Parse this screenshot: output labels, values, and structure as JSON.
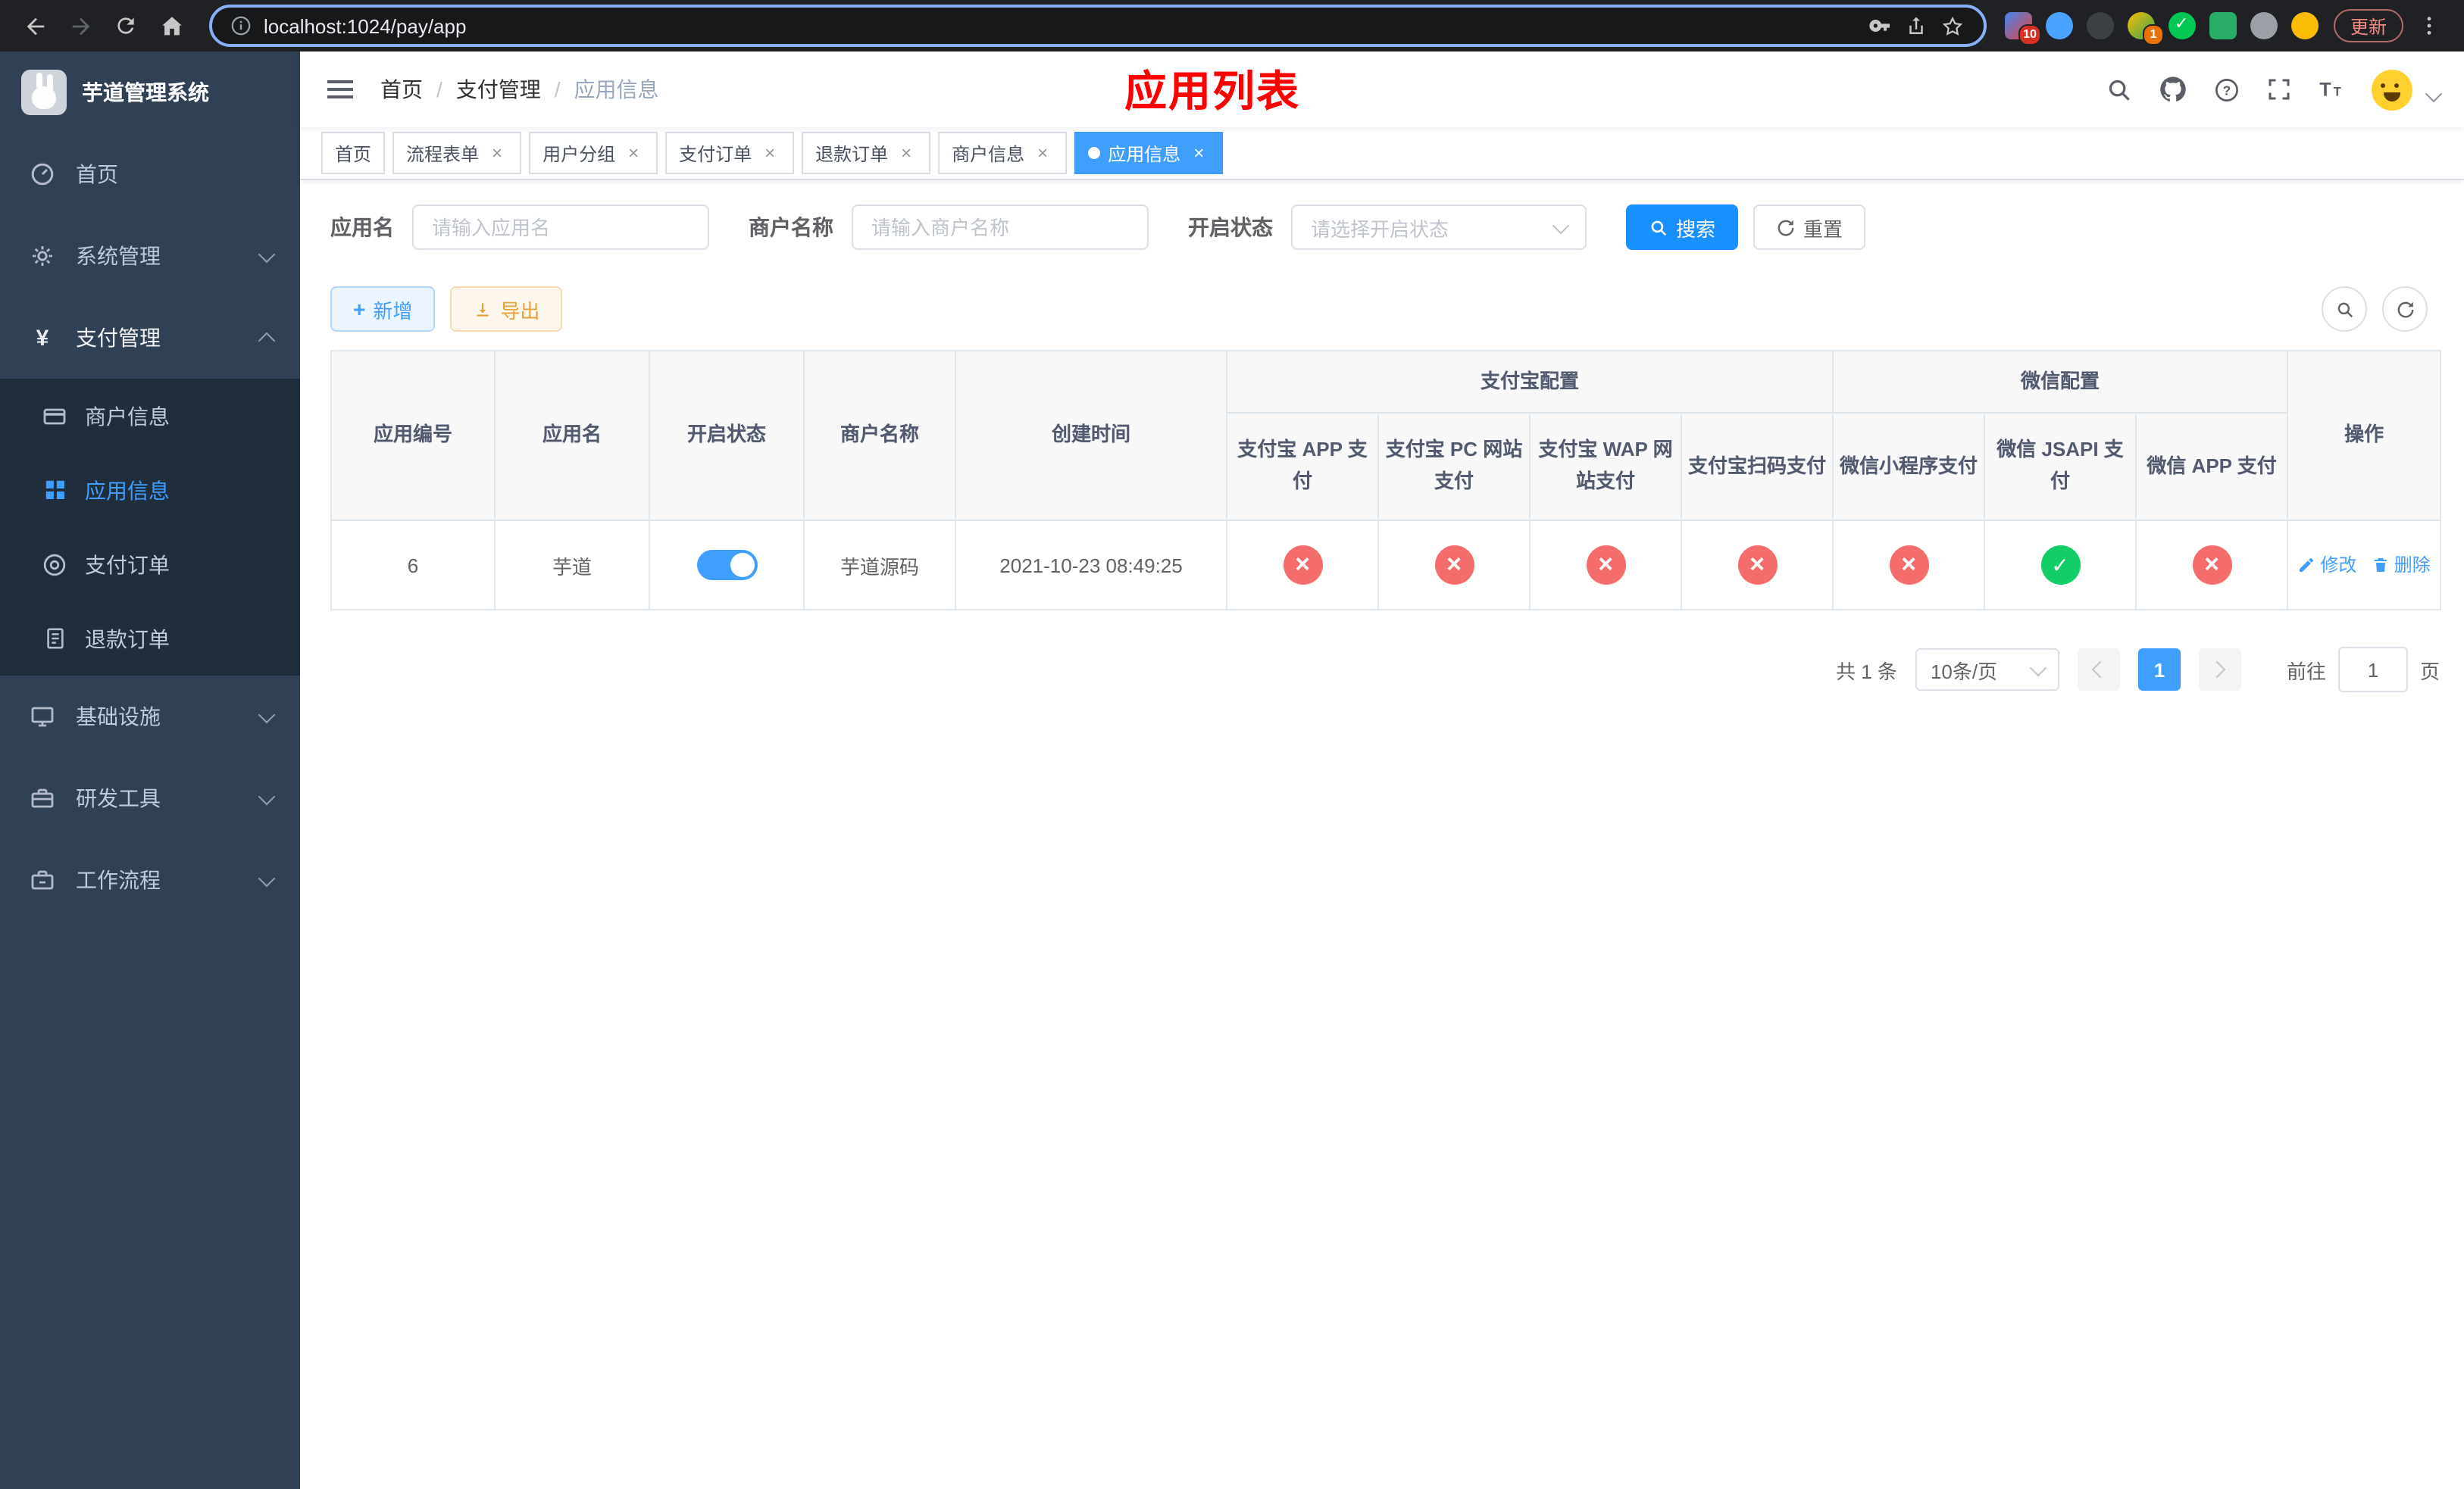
{
  "browser": {
    "url": "localhost:1024/pay/app",
    "update_label": "更新",
    "extensions_badge": "10",
    "profile_badge": "1"
  },
  "sidebar": {
    "logo_title": "芋道管理系统",
    "items": [
      {
        "label": "首页"
      },
      {
        "label": "系统管理"
      },
      {
        "label": "支付管理"
      },
      {
        "label": "商户信息"
      },
      {
        "label": "应用信息"
      },
      {
        "label": "支付订单"
      },
      {
        "label": "退款订单"
      },
      {
        "label": "基础设施"
      },
      {
        "label": "研发工具"
      },
      {
        "label": "工作流程"
      }
    ]
  },
  "breadcrumb": [
    "首页",
    "支付管理",
    "应用信息"
  ],
  "header": {
    "title": "应用列表"
  },
  "tabs": [
    {
      "label": "首页"
    },
    {
      "label": "流程表单"
    },
    {
      "label": "用户分组"
    },
    {
      "label": "支付订单"
    },
    {
      "label": "退款订单"
    },
    {
      "label": "商户信息"
    },
    {
      "label": "应用信息"
    }
  ],
  "filters": {
    "app_name_label": "应用名",
    "app_name_placeholder": "请输入应用名",
    "merchant_label": "商户名称",
    "merchant_placeholder": "请输入商户名称",
    "status_label": "开启状态",
    "status_placeholder": "请选择开启状态",
    "search_label": "搜索",
    "reset_label": "重置"
  },
  "toolbar": {
    "add_label": "新增",
    "export_label": "导出"
  },
  "table": {
    "group_alipay": "支付宝配置",
    "group_wechat": "微信配置",
    "col_app_id": "应用编号",
    "col_app_name": "应用名",
    "col_status": "开启状态",
    "col_merchant": "商户名称",
    "col_created": "创建时间",
    "col_alipay_app": "支付宝 APP 支付",
    "col_alipay_pc": "支付宝 PC 网站支付",
    "col_alipay_wap": "支付宝 WAP 网站支付",
    "col_alipay_qr": "支付宝扫码支付",
    "col_wx_mini": "微信小程序支付",
    "col_wx_jsapi": "微信 JSAPI 支付",
    "col_wx_app": "微信 APP 支付",
    "col_actions": "操作",
    "rows": [
      {
        "app_id": "6",
        "app_name": "芋道",
        "status_on": true,
        "merchant": "芋道源码",
        "created": "2021-10-23 08:49:25",
        "alipay_app_enabled": false,
        "alipay_pc_enabled": false,
        "alipay_wap_enabled": false,
        "alipay_qr_enabled": false,
        "wx_mini_enabled": false,
        "wx_jsapi_enabled": true,
        "wx_app_enabled": false,
        "edit_label": "修改",
        "delete_label": "删除"
      }
    ]
  },
  "pagination": {
    "total_label": "共 1 条",
    "page_size_label": "10条/页",
    "current_page": "1",
    "goto_label": "前往",
    "goto_value": "1",
    "goto_unit": "页"
  },
  "colors": {
    "accent": "#409eff",
    "search_button": "#1890ff",
    "danger": "#f56c6c",
    "success": "#13ce66",
    "warning": "#e6a23c",
    "title_red": "#ff0000",
    "sidebar_bg": "#304156",
    "submenu_bg": "#1f2d3d"
  }
}
